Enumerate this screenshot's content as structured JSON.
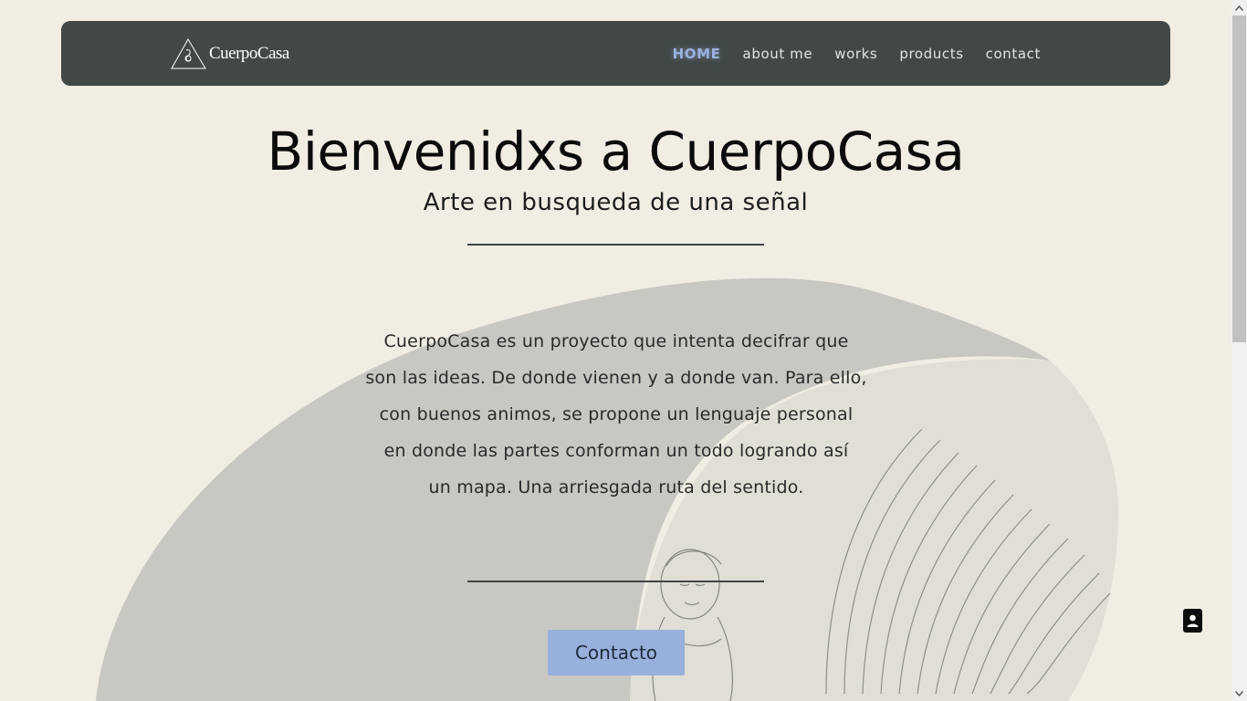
{
  "nav": {
    "logo_text": "CuerpoCasa",
    "links": [
      {
        "label": "HOME",
        "active": true
      },
      {
        "label": "about me",
        "active": false
      },
      {
        "label": "works",
        "active": false
      },
      {
        "label": "products",
        "active": false
      },
      {
        "label": "contact",
        "active": false
      }
    ]
  },
  "hero": {
    "title": "Bienvenidxs a CuerpoCasa",
    "subtitle": "Arte en busqueda de una señal",
    "body_lines": [
      "CuerpoCasa es un proyecto que intenta decifrar que",
      "son las ideas. De donde vienen y a donde van. Para ello,",
      "con buenos animos, se propone un lenguaje personal",
      "en donde las partes conforman un todo logrando así",
      "un mapa. Una arriesgada ruta del sentido."
    ],
    "cta_label": "Contacto"
  },
  "floating": {
    "contact_icon": "contact-card-icon"
  },
  "colors": {
    "background": "#f1ede3",
    "navbar": "#414847",
    "accent": "#97b0dc",
    "nav_active": "#9ab2e0"
  }
}
